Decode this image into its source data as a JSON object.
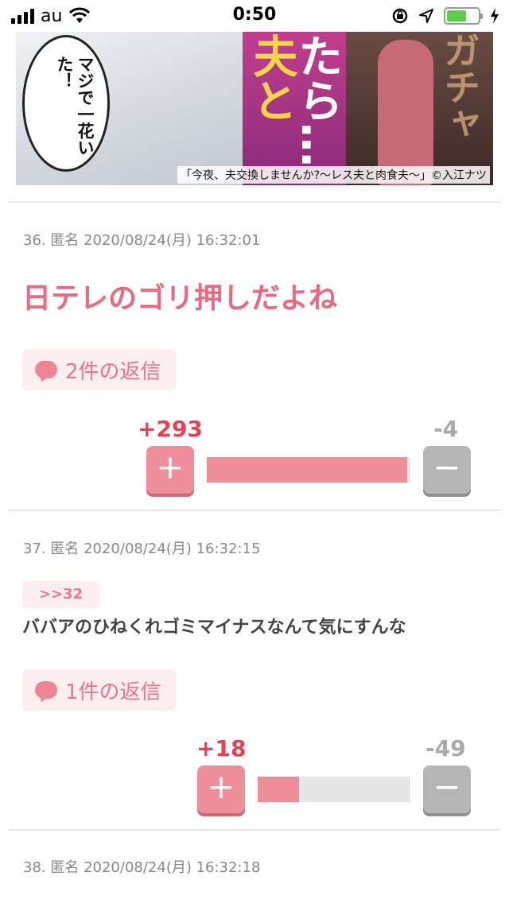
{
  "status_bar": {
    "carrier": "au",
    "time": "0:50",
    "icons": [
      "signal-icon",
      "wifi-icon",
      "rotation-lock-icon",
      "location-icon",
      "battery-icon",
      "charging-icon"
    ]
  },
  "banner": {
    "bubble_text": "マジで一花いた！",
    "title_fragment_1": "夫と",
    "title_fragment_2": "たら…",
    "sfx": "ガチャ",
    "caption": "「今夜、夫交換しませんか?〜レス夫と肉食夫〜」©入江ナツ"
  },
  "comments": [
    {
      "meta": "36. 匿名 2020/08/24(月) 16:32:01",
      "text": "日テレのゴリ押しだよね",
      "reply_label": "2件の返信",
      "plus": "+293",
      "minus": "-4",
      "plus_ratio": 0.986
    },
    {
      "meta": "37. 匿名 2020/08/24(月) 16:32:15",
      "anchor": ">>32",
      "text": "ババアのひねくれゴミマイナスなんて気にすんな",
      "reply_label": "1件の返信",
      "plus": "+18",
      "minus": "-49",
      "plus_ratio": 0.269
    },
    {
      "meta": "38. 匿名 2020/08/24(月) 16:32:18"
    }
  ],
  "vote": {
    "plus_symbol": "+",
    "minus_symbol": "−"
  },
  "colors": {
    "accent": "#e86a80",
    "plus": "#e64056",
    "minus": "#a9a9a9",
    "bar_fill": "#ee8e9b"
  }
}
